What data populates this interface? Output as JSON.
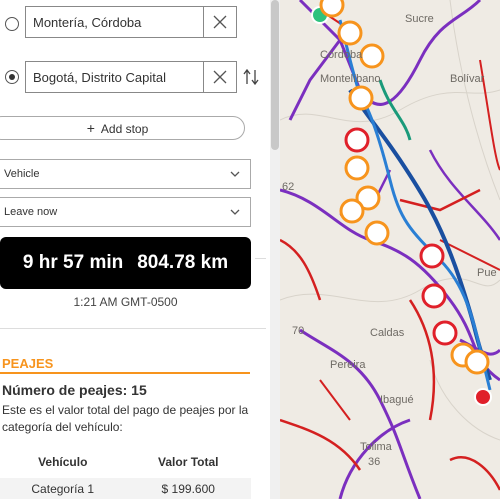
{
  "directions": {
    "origin": "Montería, Córdoba",
    "destination": "Bogotá, Distrito Capital",
    "add_stop_label": "Add stop",
    "vehicle_select": "Vehicle",
    "depart_select": "Leave now"
  },
  "summary": {
    "duration": "9 hr 57 min",
    "distance": "804.78 km",
    "arrival": "1:21 AM GMT-0500"
  },
  "peajes": {
    "heading": "PEAJES",
    "count": "Número de peajes: 15",
    "description": "Este es el valor total del pago de peajes por la categoría del vehículo:",
    "columns": [
      "Vehículo",
      "Valor Total"
    ],
    "rows": [
      {
        "category": "Categoría 1",
        "value": "$ 199.600"
      }
    ]
  },
  "map": {
    "labels": [
      "Sucre",
      "Córdoba",
      "Montelíbano",
      "Bolívar",
      "Caldas",
      "Ibagué",
      "Tolima",
      "Pereira",
      "Pue",
      "36",
      "70",
      "62"
    ],
    "colors": {
      "toll_pin": "#f7941d",
      "toll_alt": "#e0202a",
      "route": "#1a4fa0"
    }
  }
}
